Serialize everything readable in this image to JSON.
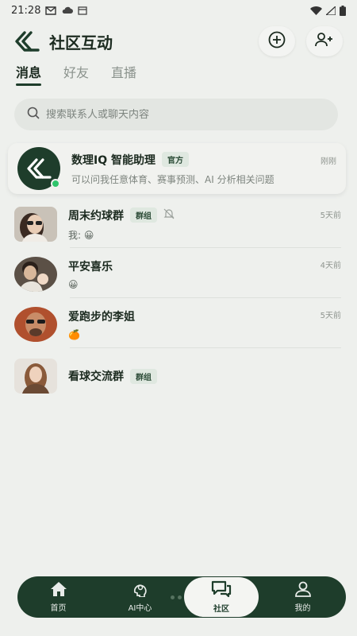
{
  "status_bar": {
    "time": "21:28"
  },
  "header": {
    "title": "社区互动"
  },
  "tabs": [
    {
      "label": "消息"
    },
    {
      "label": "好友"
    },
    {
      "label": "直播"
    }
  ],
  "search": {
    "placeholder": "搜索联系人或聊天内容"
  },
  "assistant": {
    "name": "数理IQ 智能助理",
    "badge": "官方",
    "preview": "可以问我任意体育、赛事预测、AI 分析相关问题",
    "time": "刚刚"
  },
  "chats": [
    {
      "name": "周末约球群",
      "badge": "群组",
      "preview": "我: 😀",
      "time": "5天前"
    },
    {
      "name": "平安喜乐",
      "preview": "😀",
      "time": "4天前"
    },
    {
      "name": "爱跑步的李姐",
      "preview": "🍊",
      "time": "5天前"
    },
    {
      "name": "看球交流群",
      "badge": "群组"
    }
  ],
  "nav": [
    {
      "label": "首页",
      "icon": "home-icon"
    },
    {
      "label": "AI中心",
      "icon": "ai-brain-icon"
    },
    {
      "label": "社区",
      "icon": "chat-bubbles-icon"
    },
    {
      "label": "我的",
      "icon": "user-icon"
    }
  ],
  "colors": {
    "primary": "#1e3d2b",
    "background": "#eef0ed",
    "online": "#2ec56b"
  }
}
